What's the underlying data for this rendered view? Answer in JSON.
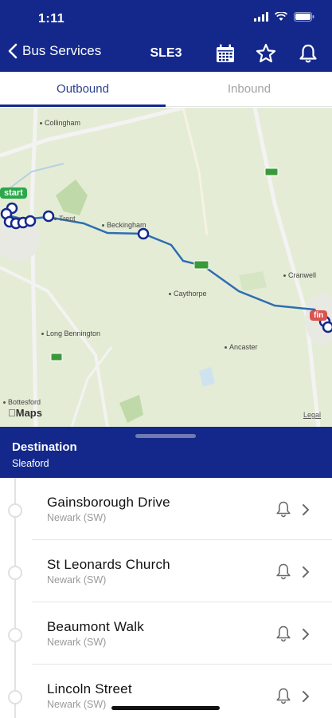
{
  "status_bar": {
    "time": "1:11",
    "icons": [
      "signal-icon",
      "wifi-icon",
      "battery-icon"
    ]
  },
  "nav": {
    "back_label": "Bus Services",
    "title": "SLE3",
    "actions": [
      "calendar-icon",
      "star-icon",
      "bell-icon"
    ]
  },
  "tabs": [
    {
      "label": "Outbound",
      "active": true
    },
    {
      "label": "Inbound",
      "active": false
    }
  ],
  "map": {
    "places": [
      "Collingham",
      "Beckingham",
      "Cranwell",
      "Caythorpe",
      "Long Bennington",
      "Ancaster",
      "Bottesford",
      "Trent"
    ],
    "start_badge": "start",
    "finish_badge": "fin",
    "provider": "Maps",
    "legal": "Legal",
    "route_color": "#2e6db4",
    "start_color": "#2aa84a",
    "finish_color": "#d9534f"
  },
  "destination": {
    "label": "Destination",
    "value": "Sleaford"
  },
  "stops": [
    {
      "name": "Gainsborough Drive",
      "area": "Newark (SW)"
    },
    {
      "name": "St Leonards Church",
      "area": "Newark (SW)"
    },
    {
      "name": "Beaumont Walk",
      "area": "Newark (SW)"
    },
    {
      "name": "Lincoln Street",
      "area": "Newark (SW)"
    }
  ],
  "colors": {
    "brand": "#13288a",
    "active_tab": "#2b3f8f"
  }
}
